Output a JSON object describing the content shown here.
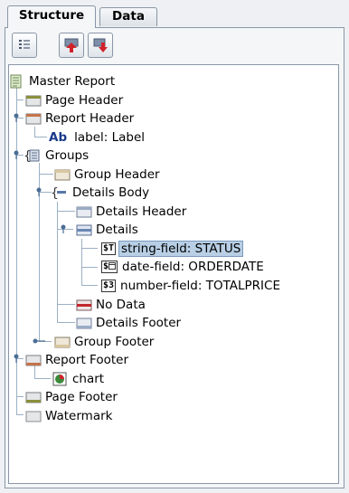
{
  "tabs": [
    {
      "label": "Structure",
      "active": true
    },
    {
      "label": "Data",
      "active": false
    }
  ],
  "toolbar": {
    "buttons": [
      {
        "icon": "list-view-icon"
      },
      {
        "icon": "move-up-icon"
      },
      {
        "icon": "move-down-icon"
      }
    ]
  },
  "tree": {
    "master_report": "Master Report",
    "page_header": "Page Header",
    "report_header": "Report Header",
    "label_prefix": "Ab",
    "label_item": "label: Label",
    "groups": "Groups",
    "group_header": "Group Header",
    "details_body": "Details Body",
    "details_header": "Details Header",
    "details": "Details",
    "string_field_badge": "$T",
    "string_field": "string-field: STATUS",
    "date_field_badge": "$",
    "date_field": "date-field: ORDERDATE",
    "number_field_badge": "$3",
    "number_field": "number-field: TOTALPRICE",
    "no_data": "No Data",
    "details_footer": "Details Footer",
    "group_footer": "Group Footer",
    "report_footer": "Report Footer",
    "chart": "chart",
    "page_footer": "Page Footer",
    "watermark": "Watermark"
  },
  "selected": "string-field: STATUS"
}
